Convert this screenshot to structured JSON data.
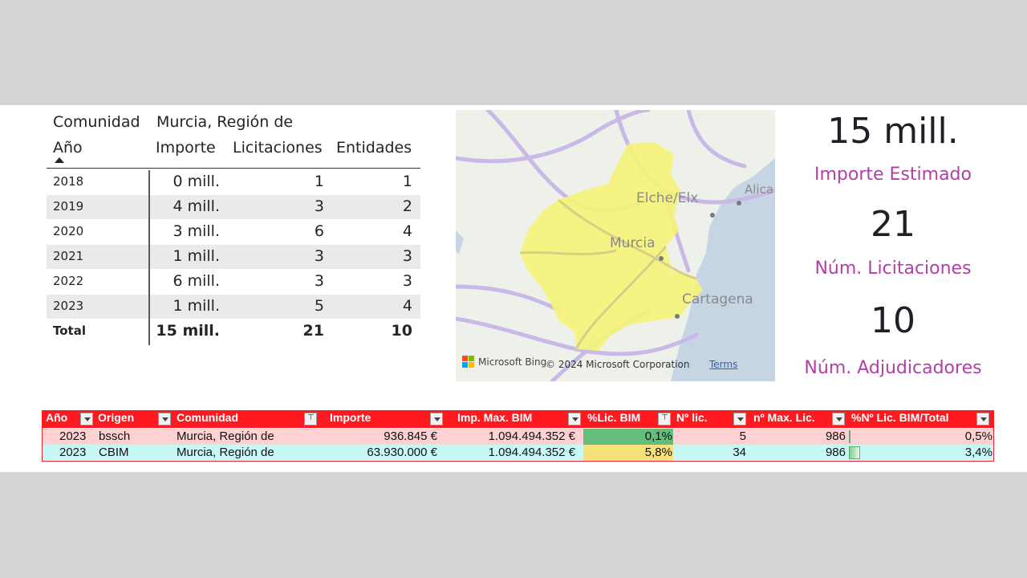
{
  "matrix": {
    "header_comunidad_label": "Comunidad",
    "header_comunidad_value": "Murcia, Región de",
    "col_year": "Año",
    "col_importe": "Importe",
    "col_licitaciones": "Licitaciones",
    "col_entidades": "Entidades",
    "rows": [
      {
        "year": "2018",
        "importe": "0 mill.",
        "licitaciones": "1",
        "entidades": "1"
      },
      {
        "year": "2019",
        "importe": "4 mill.",
        "licitaciones": "3",
        "entidades": "2"
      },
      {
        "year": "2020",
        "importe": "3 mill.",
        "licitaciones": "6",
        "entidades": "4"
      },
      {
        "year": "2021",
        "importe": "1 mill.",
        "licitaciones": "3",
        "entidades": "3"
      },
      {
        "year": "2022",
        "importe": "6 mill.",
        "licitaciones": "3",
        "entidades": "3"
      },
      {
        "year": "2023",
        "importe": "1 mill.",
        "licitaciones": "5",
        "entidades": "4"
      }
    ],
    "total": {
      "year": "Total",
      "importe": "15 mill.",
      "licitaciones": "21",
      "entidades": "10"
    }
  },
  "map": {
    "labels": {
      "elche": "Elche/Elx",
      "alicante": "Alica",
      "murcia": "Murcia",
      "cartagena": "Cartagena"
    },
    "provider": "Microsoft Bing",
    "copyright": "© 2024 Microsoft Corporation",
    "terms": "Terms",
    "region_color": "#f4f37a",
    "sea_color": "#c5d5e4"
  },
  "kpis": {
    "importe_value": "15 mill.",
    "importe_label": "Importe Estimado",
    "licitaciones_value": "21",
    "licitaciones_label": "Núm. Licitaciones",
    "adjudicadores_value": "10",
    "adjudicadores_label": "Núm. Adjudicadores",
    "label_color": "#b13fa5"
  },
  "excel": {
    "headers": [
      "Año",
      "Origen",
      "Comunidad",
      "Importe",
      "Imp. Max. BIM",
      "%Lic. BIM",
      "Nº lic.",
      "nº Max. Lic.",
      "%Nº Lic. BIM/Total"
    ],
    "rows": [
      {
        "anio": "2023",
        "origen": "bssch",
        "comunidad": "Murcia, Región de",
        "importe": "936.845 €",
        "imp_max": "1.094.494.352 €",
        "pct_lic": "0,1%",
        "n_lic": "5",
        "n_max": "986",
        "pct_total": "0,5%",
        "pct_total_value": 0.005
      },
      {
        "anio": "2023",
        "origen": "CBIM",
        "comunidad": "Murcia, Región de",
        "importe": "63.930.000 €",
        "imp_max": "1.094.494.352 €",
        "pct_lic": "5,8%",
        "n_lic": "34",
        "n_max": "986",
        "pct_total": "3,4%",
        "pct_total_value": 0.034
      }
    ],
    "header_color": "#ff1a22",
    "row1_color": "#ffd1d2",
    "row2_color": "#c8f8f6",
    "pct_green": "#63be7b",
    "pct_yellow": "#f7e17a"
  }
}
